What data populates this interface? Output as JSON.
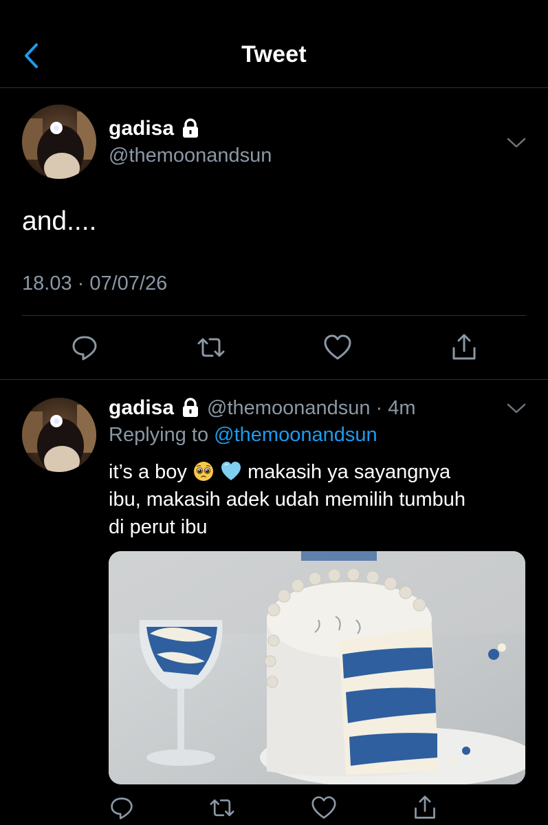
{
  "header": {
    "title": "Tweet",
    "back_icon": "chevron-left-icon",
    "accent": "#1d9bf0"
  },
  "main_tweet": {
    "name": "gadisa",
    "handle": "@themoonandsun",
    "text": "and....",
    "timestamp": "18.03 · 07/07/26",
    "actions": [
      "reply-icon",
      "retweet-icon",
      "like-icon",
      "share-icon"
    ]
  },
  "reply_tweet": {
    "name": "gadisa",
    "handle_time": "@themoonandsun · 4m",
    "replying_prefix": "Replying to ",
    "replying_to": "@themoonandsun",
    "line1_a": "it’s a boy",
    "line1_b": "makasih ya sayangnya",
    "line2": "ibu, makasih adek udah memilih tumbuh",
    "line3": "di perut ibu",
    "emojis": [
      "pleading-face-icon",
      "light-blue-heart-icon"
    ],
    "media": "cake-photo",
    "actions": [
      "reply-icon",
      "retweet-icon",
      "like-icon",
      "share-icon"
    ]
  },
  "colors": {
    "background": "#000000",
    "secondary_text": "#8b98a5",
    "link": "#1d9bf0",
    "divider": "#2f3336"
  }
}
